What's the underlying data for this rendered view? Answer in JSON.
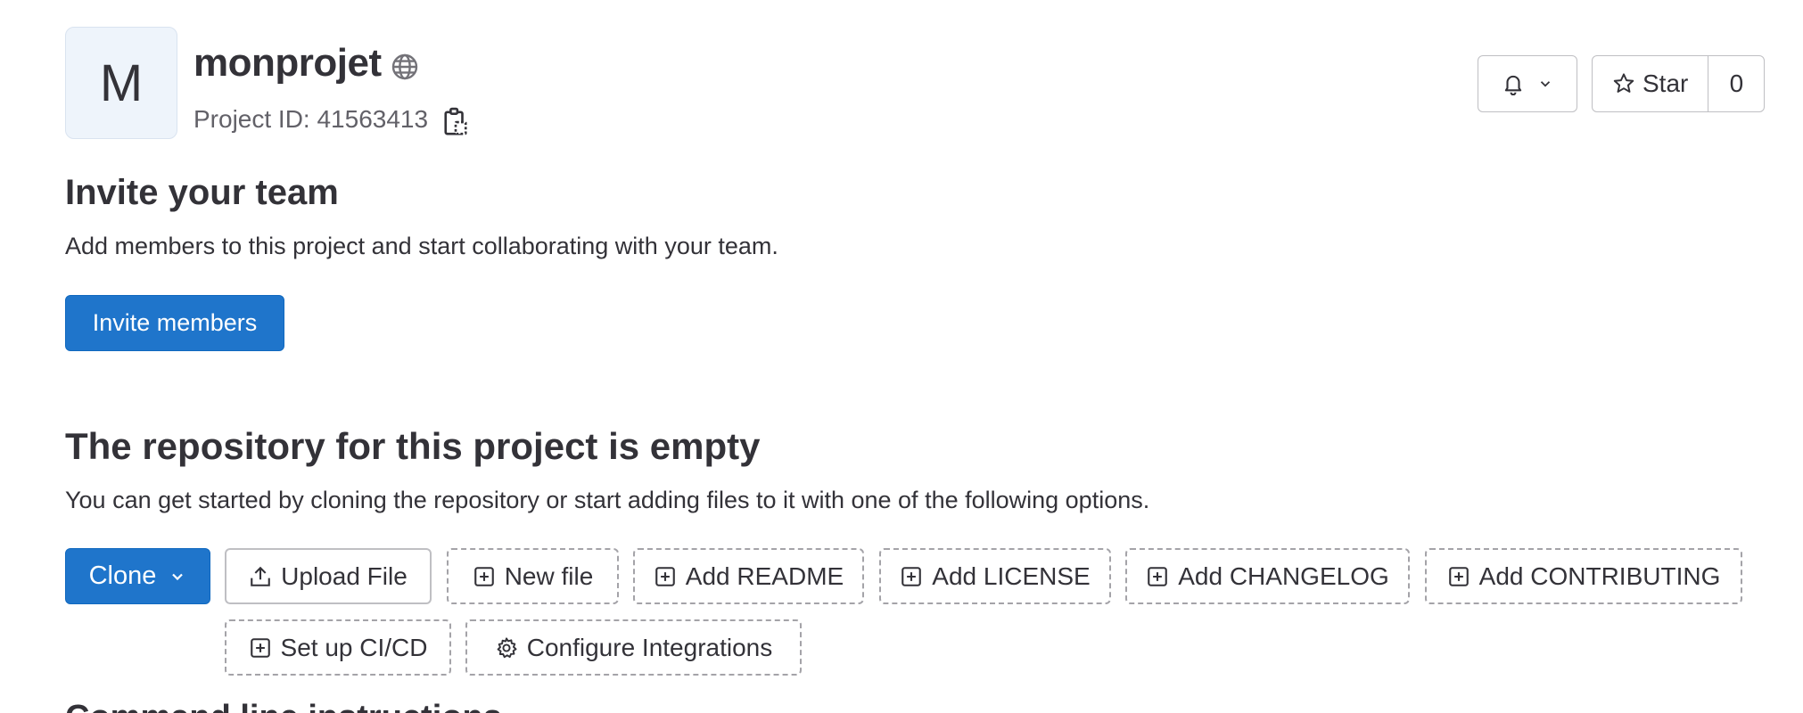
{
  "project": {
    "avatar_letter": "M",
    "name": "monprojet",
    "id_label": "Project ID: 41563413"
  },
  "header_actions": {
    "star_label": "Star",
    "star_count": "0"
  },
  "invite": {
    "heading": "Invite your team",
    "description": "Add members to this project and start collaborating with your team.",
    "button_label": "Invite members"
  },
  "empty_repo": {
    "heading": "The repository for this project is empty",
    "description": "You can get started by cloning the repository or start adding files to it with one of the following options.",
    "clone_label": "Clone",
    "actions": [
      {
        "label": "Upload File",
        "icon": "upload-icon"
      },
      {
        "label": "New file",
        "icon": "plus-square-icon"
      },
      {
        "label": "Add README",
        "icon": "plus-square-icon"
      },
      {
        "label": "Add LICENSE",
        "icon": "plus-square-icon"
      },
      {
        "label": "Add CHANGELOG",
        "icon": "plus-square-icon"
      },
      {
        "label": "Add CONTRIBUTING",
        "icon": "plus-square-icon"
      },
      {
        "label": "Set up CI/CD",
        "icon": "plus-square-icon"
      },
      {
        "label": "Configure Integrations",
        "icon": "settings-icon"
      }
    ]
  },
  "next_section": {
    "heading": "Command line instructions"
  },
  "colors": {
    "primary": "#1f75cb",
    "text": "#333238",
    "muted": "#626168",
    "border": "#bfbfc3",
    "avatar_bg": "#eef4fb"
  }
}
